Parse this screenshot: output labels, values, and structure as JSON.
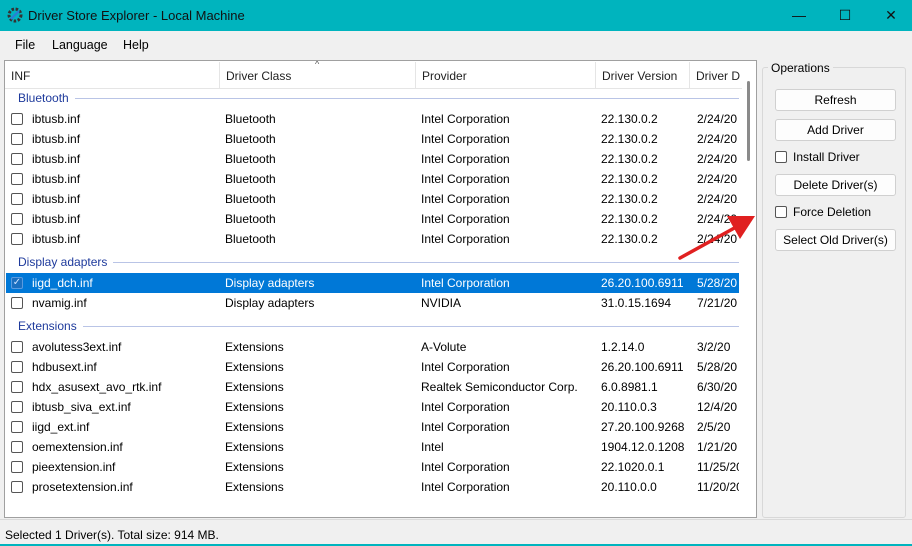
{
  "window": {
    "title": "Driver Store Explorer - Local Machine",
    "minimize": "—",
    "maximize": "☐",
    "close": "✕",
    "accent": "#00b4be"
  },
  "menu": [
    "File",
    "Language",
    "Help"
  ],
  "columns": [
    "INF",
    "Driver Class",
    "Provider",
    "Driver Version",
    "Driver D"
  ],
  "groups": [
    {
      "name": "Bluetooth",
      "rows": [
        {
          "inf": "ibtusb.inf",
          "cls": "Bluetooth",
          "provider": "Intel Corporation",
          "version": "22.130.0.2",
          "date": "2/24/20",
          "checked": false
        },
        {
          "inf": "ibtusb.inf",
          "cls": "Bluetooth",
          "provider": "Intel Corporation",
          "version": "22.130.0.2",
          "date": "2/24/20",
          "checked": false
        },
        {
          "inf": "ibtusb.inf",
          "cls": "Bluetooth",
          "provider": "Intel Corporation",
          "version": "22.130.0.2",
          "date": "2/24/20",
          "checked": false
        },
        {
          "inf": "ibtusb.inf",
          "cls": "Bluetooth",
          "provider": "Intel Corporation",
          "version": "22.130.0.2",
          "date": "2/24/20",
          "checked": false
        },
        {
          "inf": "ibtusb.inf",
          "cls": "Bluetooth",
          "provider": "Intel Corporation",
          "version": "22.130.0.2",
          "date": "2/24/20",
          "checked": false
        },
        {
          "inf": "ibtusb.inf",
          "cls": "Bluetooth",
          "provider": "Intel Corporation",
          "version": "22.130.0.2",
          "date": "2/24/20",
          "checked": false
        },
        {
          "inf": "ibtusb.inf",
          "cls": "Bluetooth",
          "provider": "Intel Corporation",
          "version": "22.130.0.2",
          "date": "2/24/20",
          "checked": false
        }
      ]
    },
    {
      "name": "Display adapters",
      "rows": [
        {
          "inf": "iigd_dch.inf",
          "cls": "Display adapters",
          "provider": "Intel Corporation",
          "version": "26.20.100.6911",
          "date": "5/28/20",
          "checked": true,
          "selected": true
        },
        {
          "inf": "nvamig.inf",
          "cls": "Display adapters",
          "provider": "NVIDIA",
          "version": "31.0.15.1694",
          "date": "7/21/20",
          "checked": false
        }
      ]
    },
    {
      "name": "Extensions",
      "rows": [
        {
          "inf": "avolutess3ext.inf",
          "cls": "Extensions",
          "provider": "A-Volute",
          "version": "1.2.14.0",
          "date": "3/2/20",
          "checked": false
        },
        {
          "inf": "hdbusext.inf",
          "cls": "Extensions",
          "provider": "Intel Corporation",
          "version": "26.20.100.6911",
          "date": "5/28/20",
          "checked": false
        },
        {
          "inf": "hdx_asusext_avo_rtk.inf",
          "cls": "Extensions",
          "provider": "Realtek Semiconductor Corp.",
          "version": "6.0.8981.1",
          "date": "6/30/20",
          "checked": false
        },
        {
          "inf": "ibtusb_siva_ext.inf",
          "cls": "Extensions",
          "provider": "Intel Corporation",
          "version": "20.110.0.3",
          "date": "12/4/20",
          "checked": false
        },
        {
          "inf": "iigd_ext.inf",
          "cls": "Extensions",
          "provider": "Intel Corporation",
          "version": "27.20.100.9268",
          "date": "2/5/20",
          "checked": false
        },
        {
          "inf": "oemextension.inf",
          "cls": "Extensions",
          "provider": "Intel",
          "version": "1904.12.0.1208",
          "date": "1/21/20",
          "checked": false
        },
        {
          "inf": "pieextension.inf",
          "cls": "Extensions",
          "provider": "Intel Corporation",
          "version": "22.1020.0.1",
          "date": "11/25/20",
          "checked": false
        },
        {
          "inf": "prosetextension.inf",
          "cls": "Extensions",
          "provider": "Intel Corporation",
          "version": "20.110.0.0",
          "date": "11/20/20",
          "checked": false
        }
      ]
    }
  ],
  "operations": {
    "label": "Operations",
    "refresh": "Refresh",
    "add_driver": "Add Driver",
    "install_driver": "Install Driver",
    "delete_drivers": "Delete Driver(s)",
    "force_deletion": "Force Deletion",
    "select_old": "Select Old Driver(s)"
  },
  "status": "Selected 1 Driver(s). Total size: 914 MB.",
  "selection_color": "#0078d7",
  "annotation_arrow_color": "#e02020"
}
